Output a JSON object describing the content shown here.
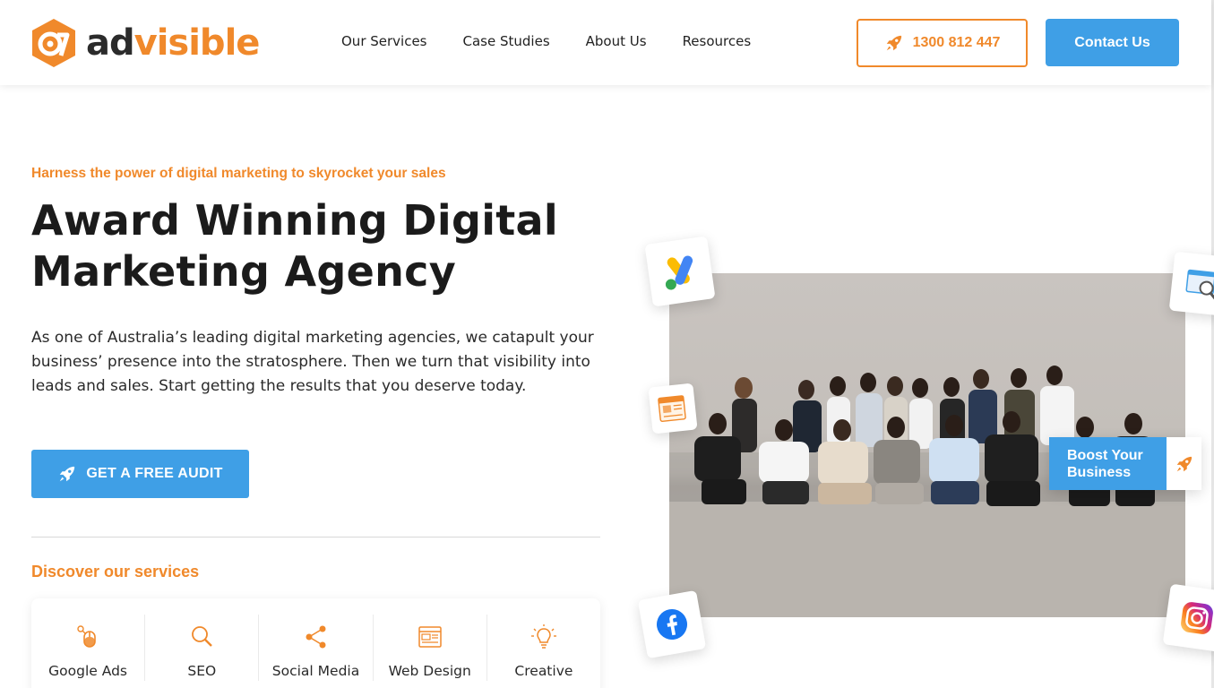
{
  "brand": {
    "name_part1": "ad",
    "name_part2": "visible",
    "accent_color": "#f0892b",
    "primary_color": "#3f9fe6"
  },
  "nav": {
    "items": [
      "Our Services",
      "Case Studies",
      "About Us",
      "Resources"
    ]
  },
  "header": {
    "phone_label": "1300 812 447",
    "contact_label": "Contact Us",
    "phone_icon": "rocket-icon"
  },
  "hero": {
    "tagline": "Harness the power of digital marketing to skyrocket your sales",
    "headline_line1": "Award Winning Digital",
    "headline_line2": "Marketing Agency",
    "description": "As one of Australia’s leading digital marketing agencies, we catapult your business’ presence into the stratosphere. Then we turn that visibility into leads and sales. Start getting the results that you deserve today.",
    "cta_label": "GET A FREE AUDIT",
    "cta_icon": "rocket-icon"
  },
  "services": {
    "heading": "Discover our services",
    "items": [
      {
        "label": "Google Ads",
        "icon": "mouse-click-icon"
      },
      {
        "label": "SEO",
        "icon": "magnifier-icon"
      },
      {
        "label": "Social Media",
        "icon": "share-icon"
      },
      {
        "label": "Web Design",
        "icon": "browser-window-icon"
      },
      {
        "label": "Creative",
        "icon": "lightbulb-icon"
      }
    ]
  },
  "floating": {
    "boost_label": "Boost Your Business",
    "badges": [
      "google-ads-logo-icon",
      "seo-browser-icon",
      "newspaper-icon",
      "facebook-logo-icon",
      "instagram-logo-icon"
    ]
  }
}
